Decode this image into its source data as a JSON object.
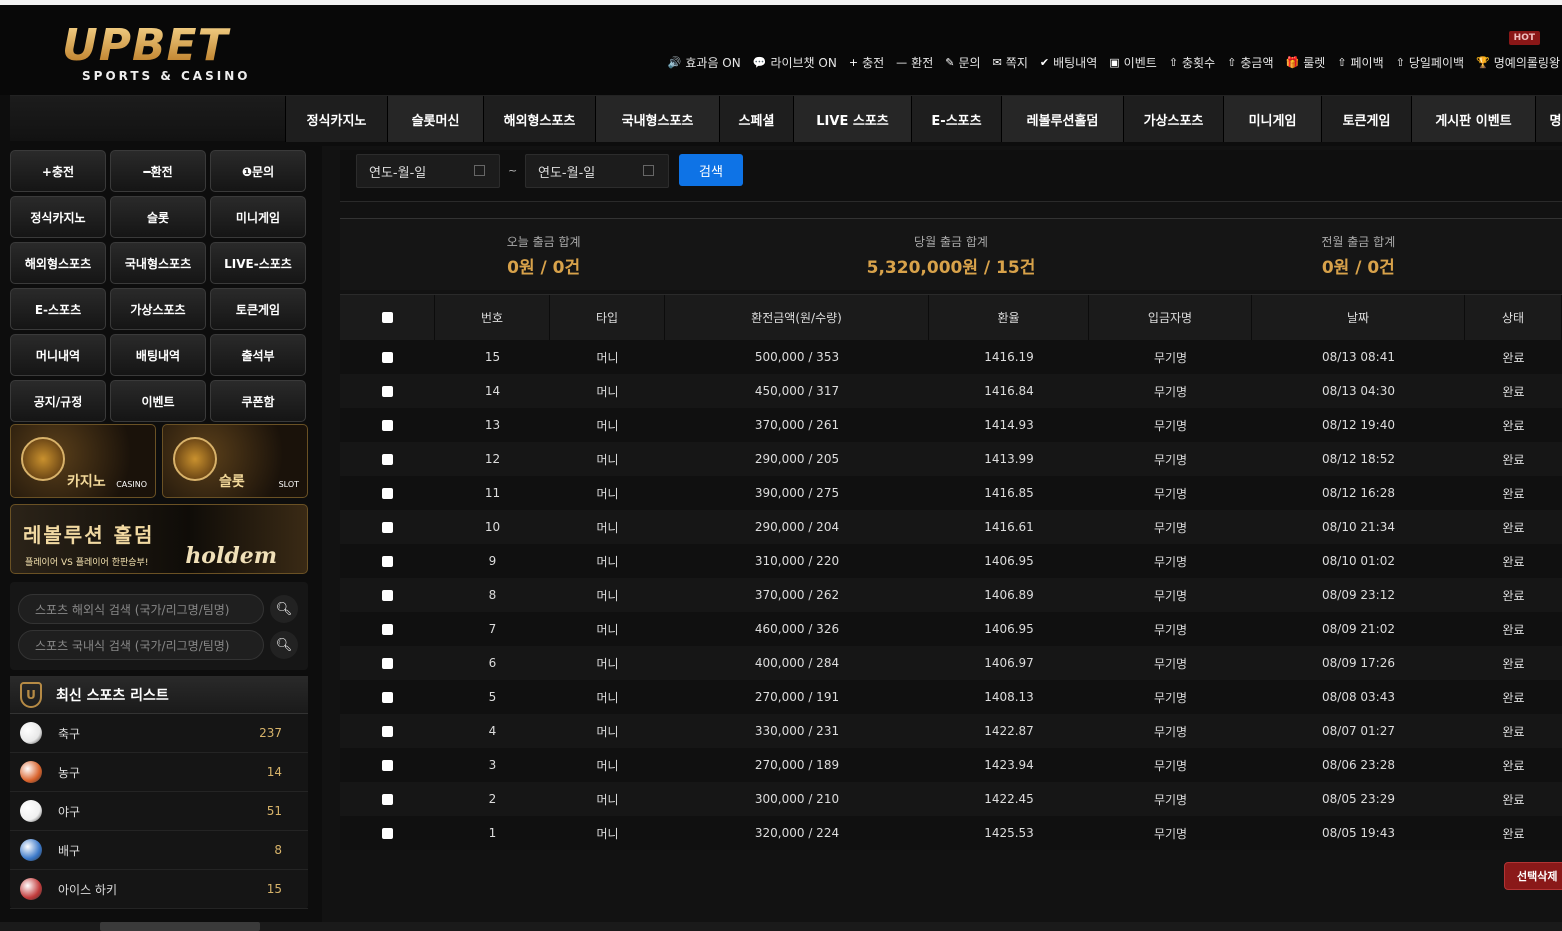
{
  "logo": {
    "brand": "UPBET",
    "sub": "SPORTS & CASINO"
  },
  "hot_badge": "HOT",
  "util_nav": [
    {
      "icon": "🔊",
      "label": "효과음 ON"
    },
    {
      "icon": "💬",
      "label": "라이브챗 ON"
    },
    {
      "icon": "+",
      "label": "충전"
    },
    {
      "icon": "—",
      "label": "환전"
    },
    {
      "icon": "✎",
      "label": "문의"
    },
    {
      "icon": "✉",
      "label": "쪽지"
    },
    {
      "icon": "✔",
      "label": "배팅내역"
    },
    {
      "icon": "▣",
      "label": "이벤트"
    },
    {
      "icon": "⇧",
      "label": "충횟수"
    },
    {
      "icon": "⇧",
      "label": "충금액"
    },
    {
      "icon": "🎁",
      "label": "룰렛"
    },
    {
      "icon": "⇧",
      "label": "페이백"
    },
    {
      "icon": "⇧",
      "label": "당일페이백"
    },
    {
      "icon": "🏆",
      "label": "명예의롤링왕"
    }
  ],
  "main_nav": [
    {
      "label": "정식카지노",
      "w": 102
    },
    {
      "label": "슬롯머신",
      "w": 96
    },
    {
      "label": "해외형스포츠",
      "w": 112
    },
    {
      "label": "국내형스포츠",
      "w": 124
    },
    {
      "label": "스페셜",
      "w": 74
    },
    {
      "label": "LIVE 스포츠",
      "w": 118
    },
    {
      "label": "E-스포츠",
      "w": 90
    },
    {
      "label": "레볼루션홀덤",
      "w": 122
    },
    {
      "label": "가상스포츠",
      "w": 100
    },
    {
      "label": "미니게임",
      "w": 98
    },
    {
      "label": "토큰게임",
      "w": 90
    },
    {
      "label": "게시판 이벤트",
      "w": 124
    },
    {
      "label": "명",
      "w": 40
    }
  ],
  "sidebar_buttons": [
    "+충전",
    "━환전",
    "❶문의",
    "정식카지노",
    "슬롯",
    "미니게임",
    "해외형스포츠",
    "국내형스포츠",
    "LIVE-스포츠",
    "E-스포츠",
    "가상스포츠",
    "토큰게임",
    "머니내역",
    "배팅내역",
    "출석부",
    "공지/규정",
    "이벤트",
    "쿠폰함"
  ],
  "banners": {
    "casino": {
      "label": "카지노",
      "tag": "CASINO"
    },
    "slot": {
      "label": "슬롯",
      "tag": "SLOT"
    },
    "holdem": {
      "title": "레볼루션 홀덤",
      "sub": "플레이어 VS 플레이어 한판승부!",
      "logo": "holdem"
    }
  },
  "search": {
    "overseas_placeholder": "스포츠 해외식 검색 (국가/리그명/팀명)",
    "domestic_placeholder": "스포츠 국내식 검색 (국가/리그명/팀명)"
  },
  "sports_list": {
    "title": "최신 스포츠 리스트",
    "items": [
      {
        "name": "축구",
        "count": "237",
        "color": "#e8e8e8"
      },
      {
        "name": "농구",
        "count": "14",
        "color": "#d9622b"
      },
      {
        "name": "야구",
        "count": "51",
        "color": "#f0f0f0"
      },
      {
        "name": "배구",
        "count": "8",
        "color": "#3a78c9"
      },
      {
        "name": "아이스 하키",
        "count": "15",
        "color": "#c23b3b"
      }
    ]
  },
  "filter": {
    "date_from": "연도-월-일",
    "tilde": "~",
    "date_to": "연도-월-일",
    "search_label": "검색"
  },
  "summary": [
    {
      "label": "오늘 출금 합계",
      "value": "0원 / 0건"
    },
    {
      "label": "당월 출금 합계",
      "value": "5,320,000원 / 15건"
    },
    {
      "label": "전월 출금 합계",
      "value": "0원 / 0건"
    }
  ],
  "table": {
    "headers": [
      "",
      "번호",
      "타입",
      "환전금액(원/수량)",
      "환율",
      "입금자명",
      "날짜",
      "상태"
    ],
    "rows": [
      [
        "15",
        "머니",
        "500,000 / 353",
        "1416.19",
        "무기명",
        "08/13 08:41",
        "완료"
      ],
      [
        "14",
        "머니",
        "450,000 / 317",
        "1416.84",
        "무기명",
        "08/13 04:30",
        "완료"
      ],
      [
        "13",
        "머니",
        "370,000 / 261",
        "1414.93",
        "무기명",
        "08/12 19:40",
        "완료"
      ],
      [
        "12",
        "머니",
        "290,000 / 205",
        "1413.99",
        "무기명",
        "08/12 18:52",
        "완료"
      ],
      [
        "11",
        "머니",
        "390,000 / 275",
        "1416.85",
        "무기명",
        "08/12 16:28",
        "완료"
      ],
      [
        "10",
        "머니",
        "290,000 / 204",
        "1416.61",
        "무기명",
        "08/10 21:34",
        "완료"
      ],
      [
        "9",
        "머니",
        "310,000 / 220",
        "1406.95",
        "무기명",
        "08/10 01:02",
        "완료"
      ],
      [
        "8",
        "머니",
        "370,000 / 262",
        "1406.89",
        "무기명",
        "08/09 23:12",
        "완료"
      ],
      [
        "7",
        "머니",
        "460,000 / 326",
        "1406.95",
        "무기명",
        "08/09 21:02",
        "완료"
      ],
      [
        "6",
        "머니",
        "400,000 / 284",
        "1406.97",
        "무기명",
        "08/09 17:26",
        "완료"
      ],
      [
        "5",
        "머니",
        "270,000 / 191",
        "1408.13",
        "무기명",
        "08/08 03:43",
        "완료"
      ],
      [
        "4",
        "머니",
        "330,000 / 231",
        "1422.87",
        "무기명",
        "08/07 01:27",
        "완료"
      ],
      [
        "3",
        "머니",
        "270,000 / 189",
        "1423.94",
        "무기명",
        "08/06 23:28",
        "완료"
      ],
      [
        "2",
        "머니",
        "300,000 / 210",
        "1422.45",
        "무기명",
        "08/05 23:29",
        "완료"
      ],
      [
        "1",
        "머니",
        "320,000 / 224",
        "1425.53",
        "무기명",
        "08/05 19:43",
        "완료"
      ]
    ]
  },
  "delete_selected_label": "선택삭제"
}
